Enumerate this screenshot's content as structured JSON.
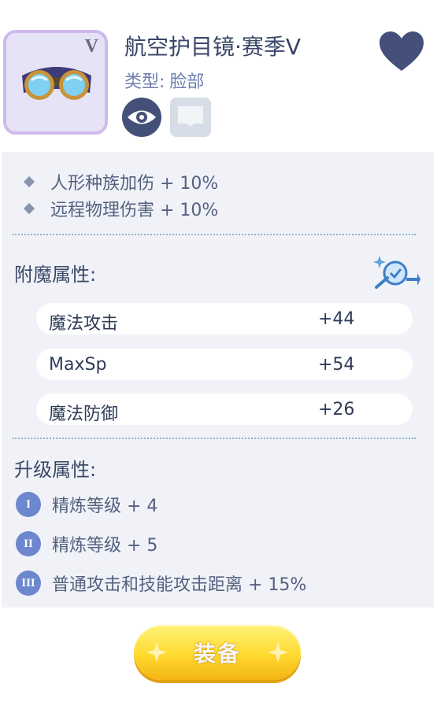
{
  "item": {
    "name": "航空护目镜·赛季V",
    "rank_mark": "V",
    "type_label": "类型:",
    "type_value": "脸部"
  },
  "base_attributes": [
    "人形种族加伤 + 10%",
    "远程物理伤害 + 10%"
  ],
  "enchant": {
    "title": "附魔属性:",
    "rows": [
      {
        "name": "魔法攻击",
        "value": "+44"
      },
      {
        "name": "MaxSp",
        "value": "+54"
      },
      {
        "name": "魔法防御",
        "value": "+26"
      }
    ]
  },
  "upgrade": {
    "title": "升级属性:",
    "rows": [
      {
        "badge": "I",
        "text": "精炼等级 + 4"
      },
      {
        "badge": "II",
        "text": "精炼等级 + 5"
      },
      {
        "badge": "III",
        "text": "普通攻击和技能攻击距离 + 15%"
      }
    ]
  },
  "equip_button_label": "装备",
  "icons": [
    "goggles-icon",
    "eye-icon",
    "tray-icon",
    "heart-icon",
    "magic-wand-icon",
    "sparkle-icon"
  ],
  "colors": {
    "accent_blue": "#44507a",
    "panel_bg": "#f0f2f8",
    "frame_purple": "#cfb9ee",
    "button_yellow": "#ffd92e",
    "badge_blue": "#6d87cf"
  }
}
